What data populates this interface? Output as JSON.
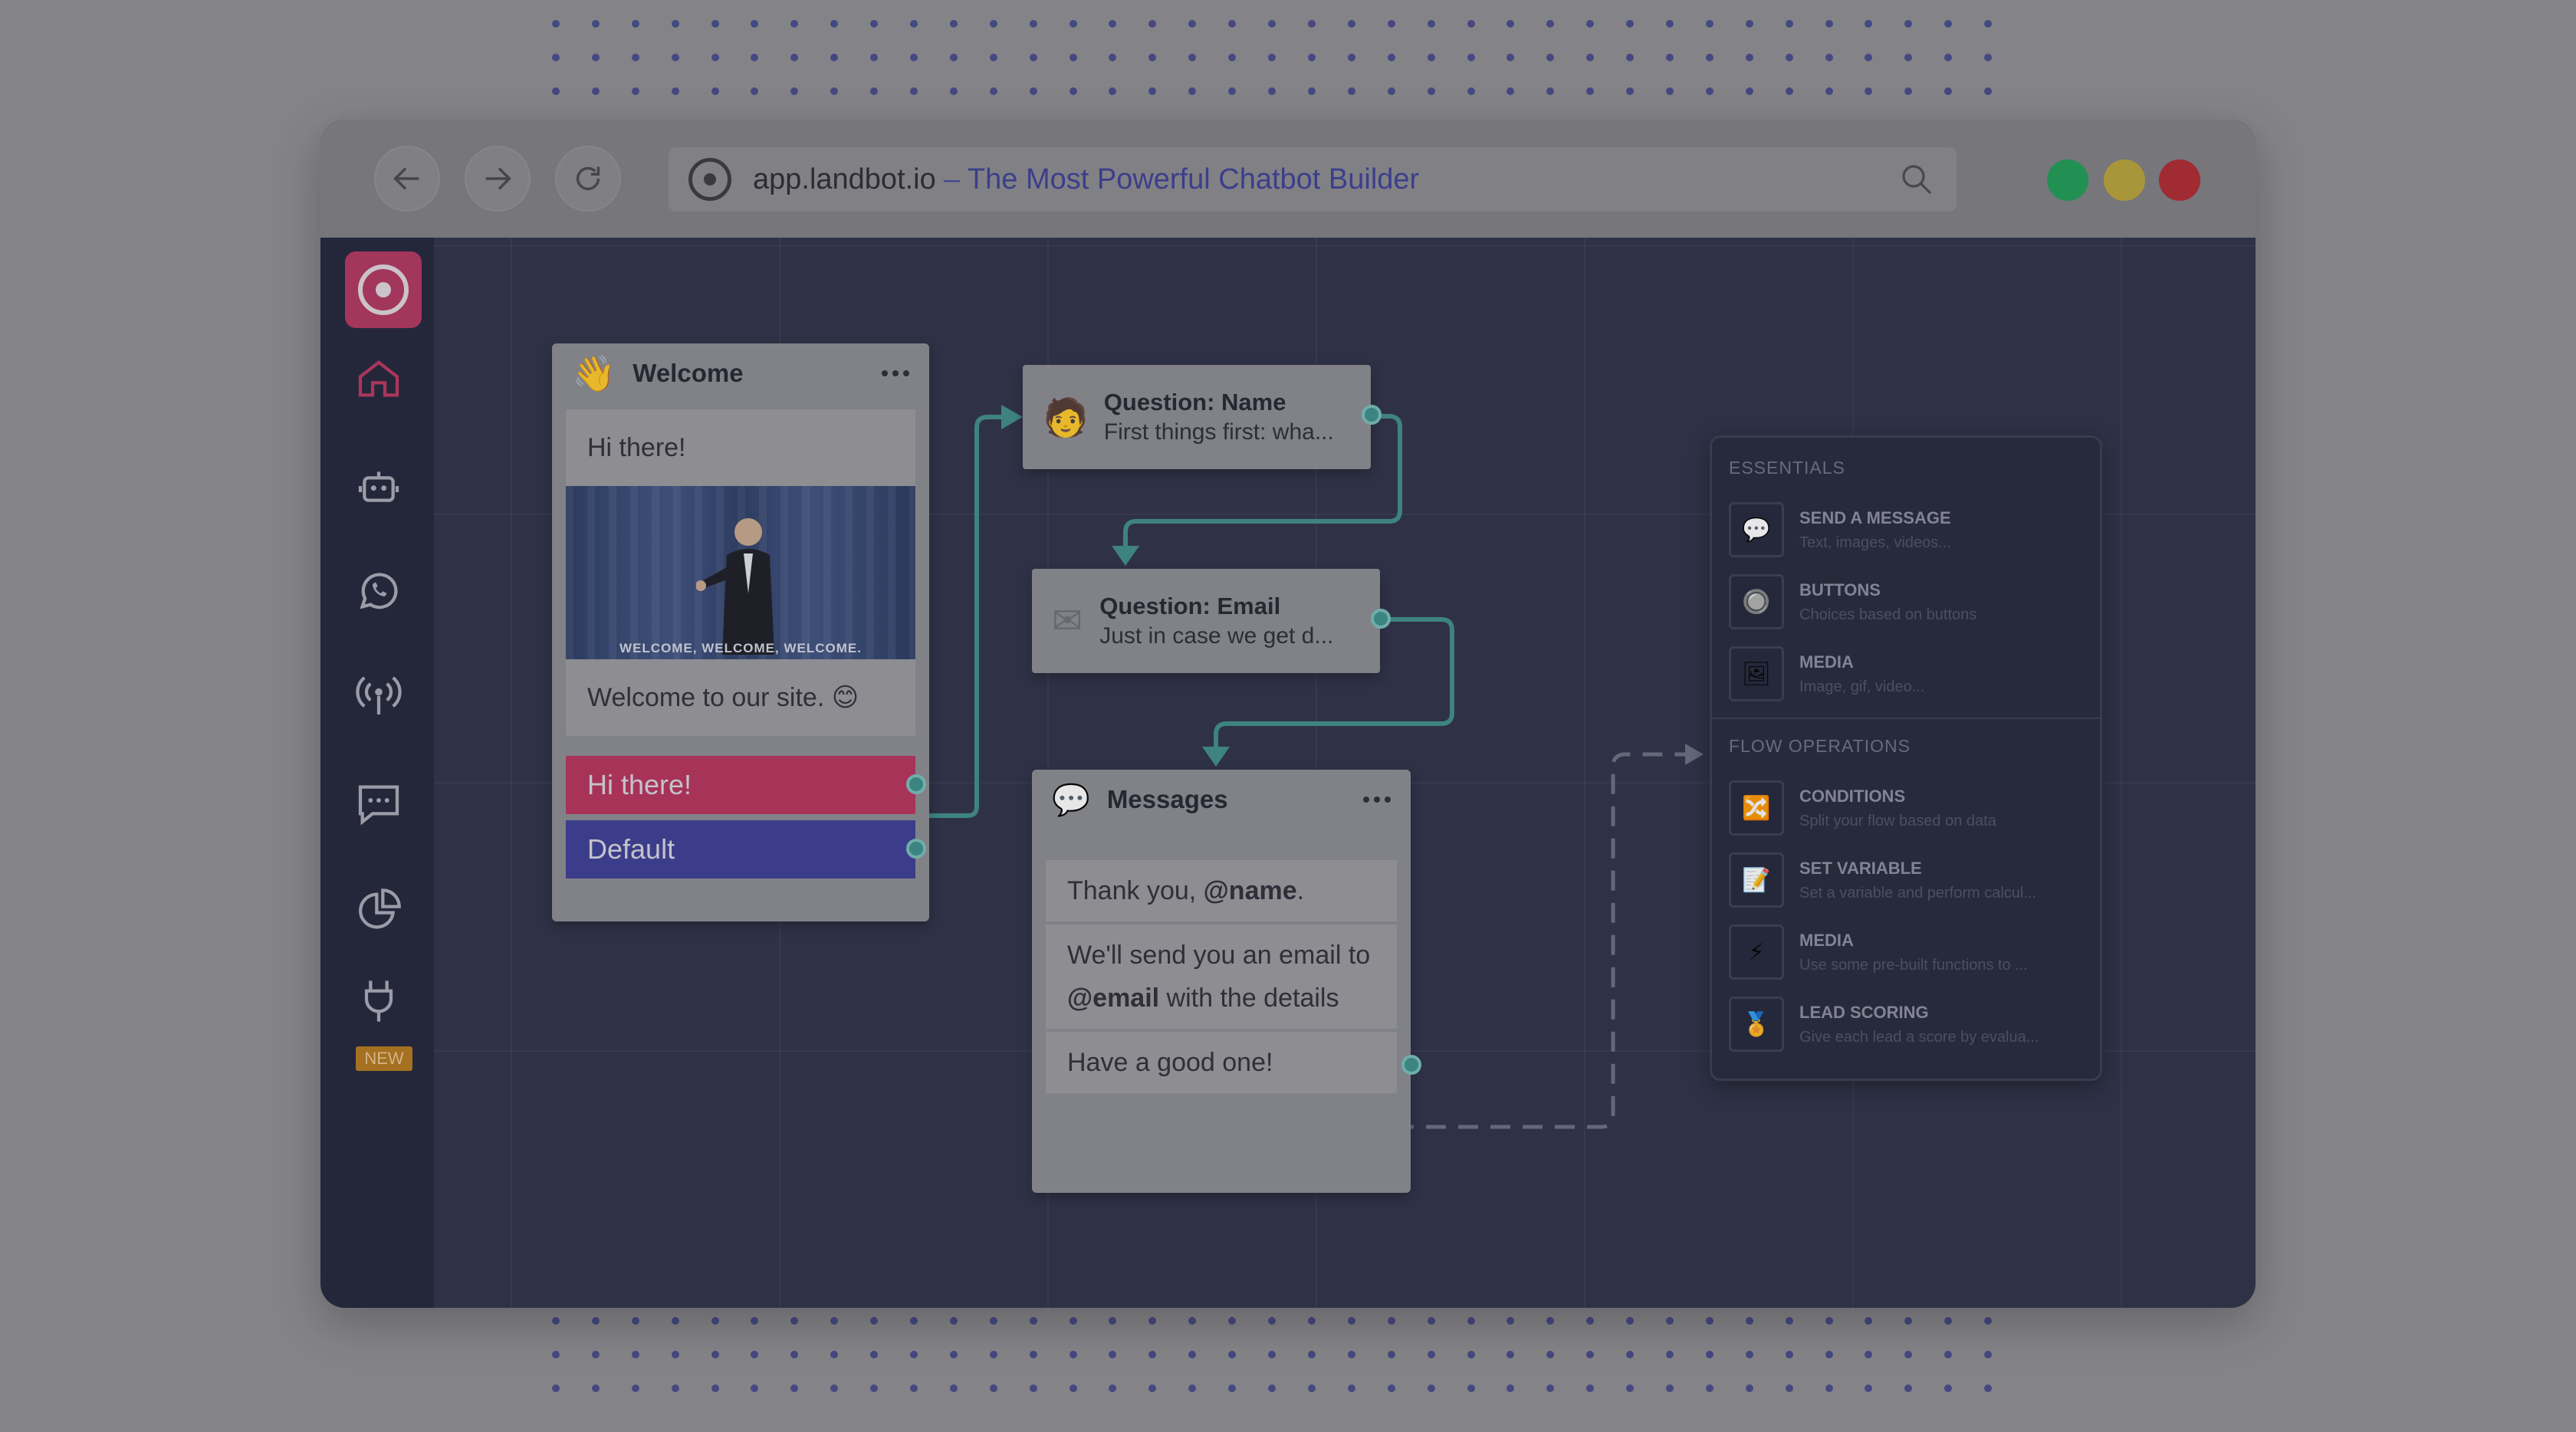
{
  "browser": {
    "domain": "app.landbot.io",
    "separator": "–",
    "title": "The Most Powerful Chatbot Builder",
    "traffic_lights": [
      "#1f9d55",
      "#b9a23a",
      "#b02a30"
    ]
  },
  "sidebar": {
    "items": [
      {
        "icon": "home-icon"
      },
      {
        "icon": "bot-icon"
      },
      {
        "icon": "whatsapp-icon"
      },
      {
        "icon": "broadcast-icon"
      },
      {
        "icon": "chat-icon"
      },
      {
        "icon": "analytics-icon"
      },
      {
        "icon": "plug-icon",
        "badge": "NEW"
      }
    ]
  },
  "flow": {
    "welcome": {
      "title": "Welcome",
      "emoji": "👋",
      "greeting": "Hi there!",
      "gif_caption": "WELCOME, WELCOME, WELCOME.",
      "message": "Welcome to our site. 😊",
      "buttons": [
        {
          "label": "Hi there!",
          "color": "#b8335c"
        },
        {
          "label": "Default",
          "color": "#3d3e95"
        }
      ]
    },
    "question_name": {
      "title": "Question: Name",
      "subtitle": "First things first: wha...",
      "emoji": "🧑"
    },
    "question_email": {
      "title": "Question: Email",
      "subtitle": "Just in case we get d...",
      "emoji": "✉"
    },
    "messages": {
      "title": "Messages",
      "emoji": "💬",
      "bubbles": [
        {
          "prefix": "Thank you, ",
          "bold": "@name",
          "suffix": "."
        },
        {
          "prefix": "We'll send you an email to ",
          "bold": "@email",
          "suffix": " with the details"
        },
        {
          "prefix": "Have a good one!",
          "bold": "",
          "suffix": ""
        }
      ]
    }
  },
  "panel": {
    "essentials_header": "ESSENTIALS",
    "essentials": [
      {
        "name": "SEND A MESSAGE",
        "desc": "Text, images, videos...",
        "icon": "💬"
      },
      {
        "name": "BUTTONS",
        "desc": "Choices based on buttons",
        "icon": "🔘"
      },
      {
        "name": "MEDIA",
        "desc": "Image, gif, video...",
        "icon": "🖼"
      }
    ],
    "flow_header": "FLOW OPERATIONS",
    "flow_ops": [
      {
        "name": "CONDITIONS",
        "desc": "Split your flow based on data",
        "icon": "🔀"
      },
      {
        "name": "SET VARIABLE",
        "desc": "Set a variable and perform calcul...",
        "icon": "📝"
      },
      {
        "name": "MEDIA",
        "desc": "Use some pre-built functions to ...",
        "icon": "⚡"
      },
      {
        "name": "LEAD SCORING",
        "desc": "Give each lead a score by evalua...",
        "icon": "🏅"
      }
    ]
  }
}
